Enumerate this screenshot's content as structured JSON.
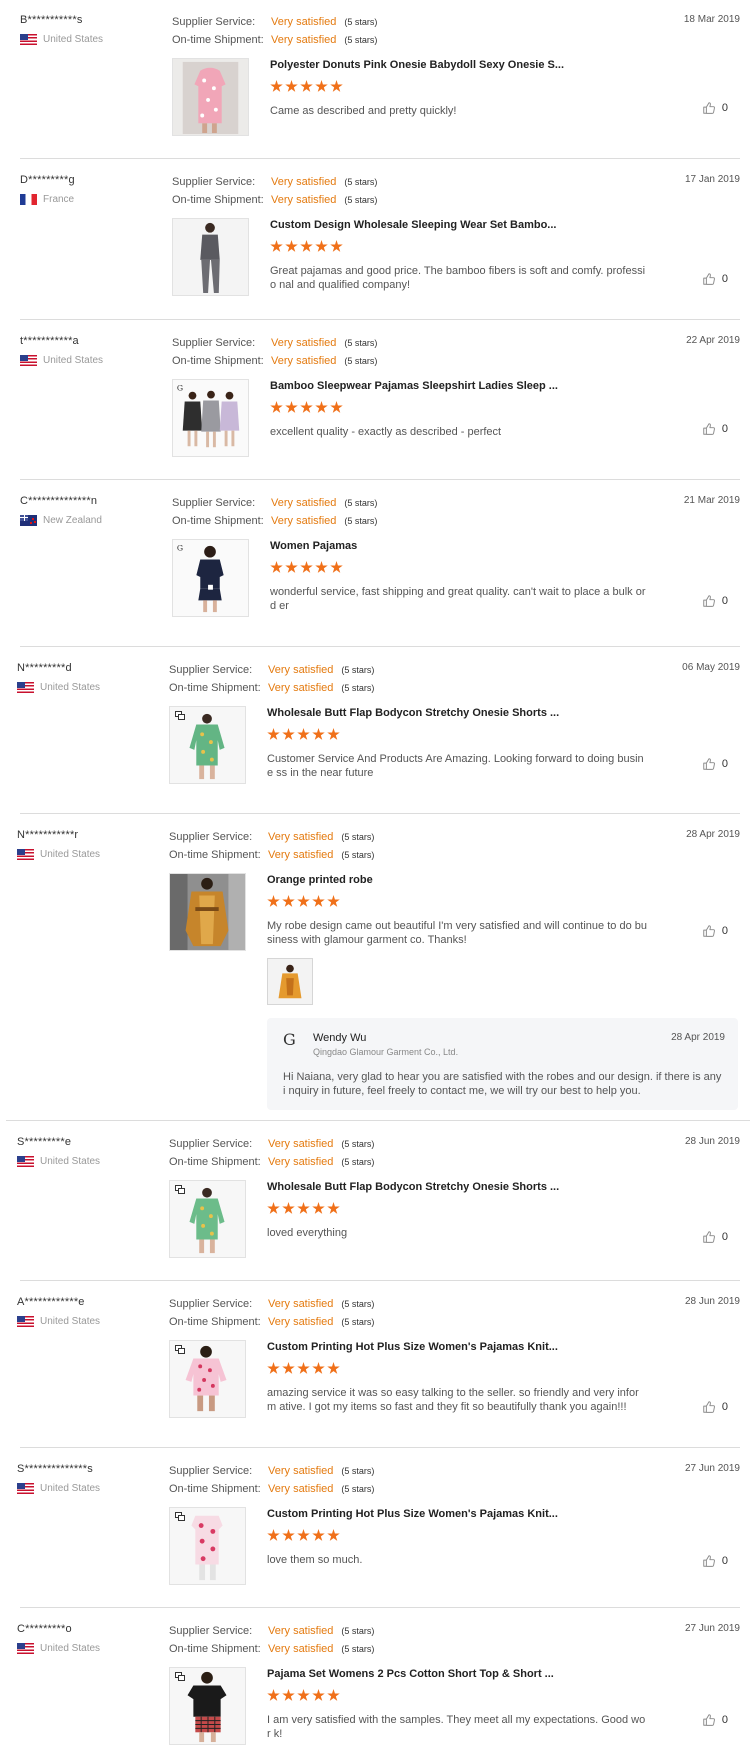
{
  "labels": {
    "supplier_service": "Supplier Service:",
    "on_time_shipment": "On-time Shipment:"
  },
  "colors": {
    "satisfied": "#e47a0f",
    "star": "#f07019"
  },
  "reviews": [
    {
      "buyer": "B***********s",
      "country": "United States",
      "flag": "us",
      "supplier_service": "Very satisfied",
      "supplier_stars": "(5 stars)",
      "shipment": "Very satisfied",
      "shipment_stars": "(5 stars)",
      "date": "18 Mar 2019",
      "product_title": "Polyester Donuts Pink Onesie Babydoll Sexy Onesie S...",
      "rating": 5,
      "comment": "Came as described and pretty quickly!",
      "likes": "0"
    },
    {
      "buyer": "D*********g",
      "country": "France",
      "flag": "fr",
      "supplier_service": "Very satisfied",
      "supplier_stars": "(5 stars)",
      "shipment": "Very satisfied",
      "shipment_stars": "(5 stars)",
      "date": "17 Jan 2019",
      "product_title": "Custom Design Wholesale Sleeping Wear Set Bambo...",
      "rating": 5,
      "comment": "Great pajamas and good price. The bamboo fibers is soft and comfy. professio nal and qualified company!",
      "likes": "0"
    },
    {
      "buyer": "t***********a",
      "country": "United States",
      "flag": "us",
      "supplier_service": "Very satisfied",
      "supplier_stars": "(5 stars)",
      "shipment": "Very satisfied",
      "shipment_stars": "(5 stars)",
      "date": "22 Apr 2019",
      "product_title": "Bamboo Sleepwear Pajamas Sleepshirt Ladies Sleep ...",
      "rating": 5,
      "comment": "excellent quality - exactly as described - perfect",
      "likes": "0"
    },
    {
      "buyer": "C**************n",
      "country": "New Zealand",
      "flag": "nz",
      "supplier_service": "Very satisfied",
      "supplier_stars": "(5 stars)",
      "shipment": "Very satisfied",
      "shipment_stars": "(5 stars)",
      "date": "21 Mar 2019",
      "product_title": "Women Pajamas",
      "rating": 5,
      "comment": "wonderful service, fast shipping and great quality. can't wait to place a bulk ord er",
      "likes": "0"
    },
    {
      "buyer": "N*********d",
      "country": "United States",
      "flag": "us",
      "supplier_service": "Very satisfied",
      "supplier_stars": "(5 stars)",
      "shipment": "Very satisfied",
      "shipment_stars": "(5 stars)",
      "date": "06 May 2019",
      "product_title": "Wholesale Butt Flap Bodycon Stretchy Onesie Shorts ...",
      "rating": 5,
      "comment": "Customer Service And Products Are Amazing. Looking forward to doing busine ss in the near future",
      "likes": "0"
    },
    {
      "buyer": "N***********r",
      "country": "United States",
      "flag": "us",
      "supplier_service": "Very satisfied",
      "supplier_stars": "(5 stars)",
      "shipment": "Very satisfied",
      "shipment_stars": "(5 stars)",
      "date": "28 Apr 2019",
      "product_title": "Orange printed robe",
      "rating": 5,
      "comment": "My robe design came out beautiful I'm very satisfied and will continue to do bu siness with glamour garment co. Thanks!",
      "likes": "0",
      "reply": {
        "logo": "G",
        "name": "Wendy Wu",
        "company": "Qingdao Glamour Garment Co., Ltd.",
        "date": "28 Apr 2019",
        "text": "Hi Naiana, very glad to hear you are satisfied with the robes and our design. if there is any i nquiry in future, feel freely to contact me, we will try our best to help you."
      }
    },
    {
      "buyer": "S*********e",
      "country": "United States",
      "flag": "us",
      "supplier_service": "Very satisfied",
      "supplier_stars": "(5 stars)",
      "shipment": "Very satisfied",
      "shipment_stars": "(5 stars)",
      "date": "28 Jun 2019",
      "product_title": "Wholesale Butt Flap Bodycon Stretchy Onesie Shorts ...",
      "rating": 5,
      "comment": "loved everything",
      "likes": "0"
    },
    {
      "buyer": "A************e",
      "country": "United States",
      "flag": "us",
      "supplier_service": "Very satisfied",
      "supplier_stars": "(5 stars)",
      "shipment": "Very satisfied",
      "shipment_stars": "(5 stars)",
      "date": "28 Jun 2019",
      "product_title": "Custom Printing Hot Plus Size Women's Pajamas Knit...",
      "rating": 5,
      "comment": "amazing service it was so easy talking to the seller. so friendly and very inform ative. I got my items so fast and they fit so beautifully thank you again!!!",
      "likes": "0"
    },
    {
      "buyer": "S**************s",
      "country": "United States",
      "flag": "us",
      "supplier_service": "Very satisfied",
      "supplier_stars": "(5 stars)",
      "shipment": "Very satisfied",
      "shipment_stars": "(5 stars)",
      "date": "27 Jun 2019",
      "product_title": "Custom Printing Hot Plus Size Women's Pajamas Knit...",
      "rating": 5,
      "comment": "love them so much.",
      "likes": "0"
    },
    {
      "buyer": "C*********o",
      "country": "United States",
      "flag": "us",
      "supplier_service": "Very satisfied",
      "supplier_stars": "(5 stars)",
      "shipment": "Very satisfied",
      "shipment_stars": "(5 stars)",
      "date": "27 Jun 2019",
      "product_title": "Pajama Set Womens 2 Pcs Cotton Short Top & Short ...",
      "rating": 5,
      "comment": "I am very satisfied with the samples. They meet all my expectations.  Good wor k!",
      "likes": "0"
    }
  ]
}
